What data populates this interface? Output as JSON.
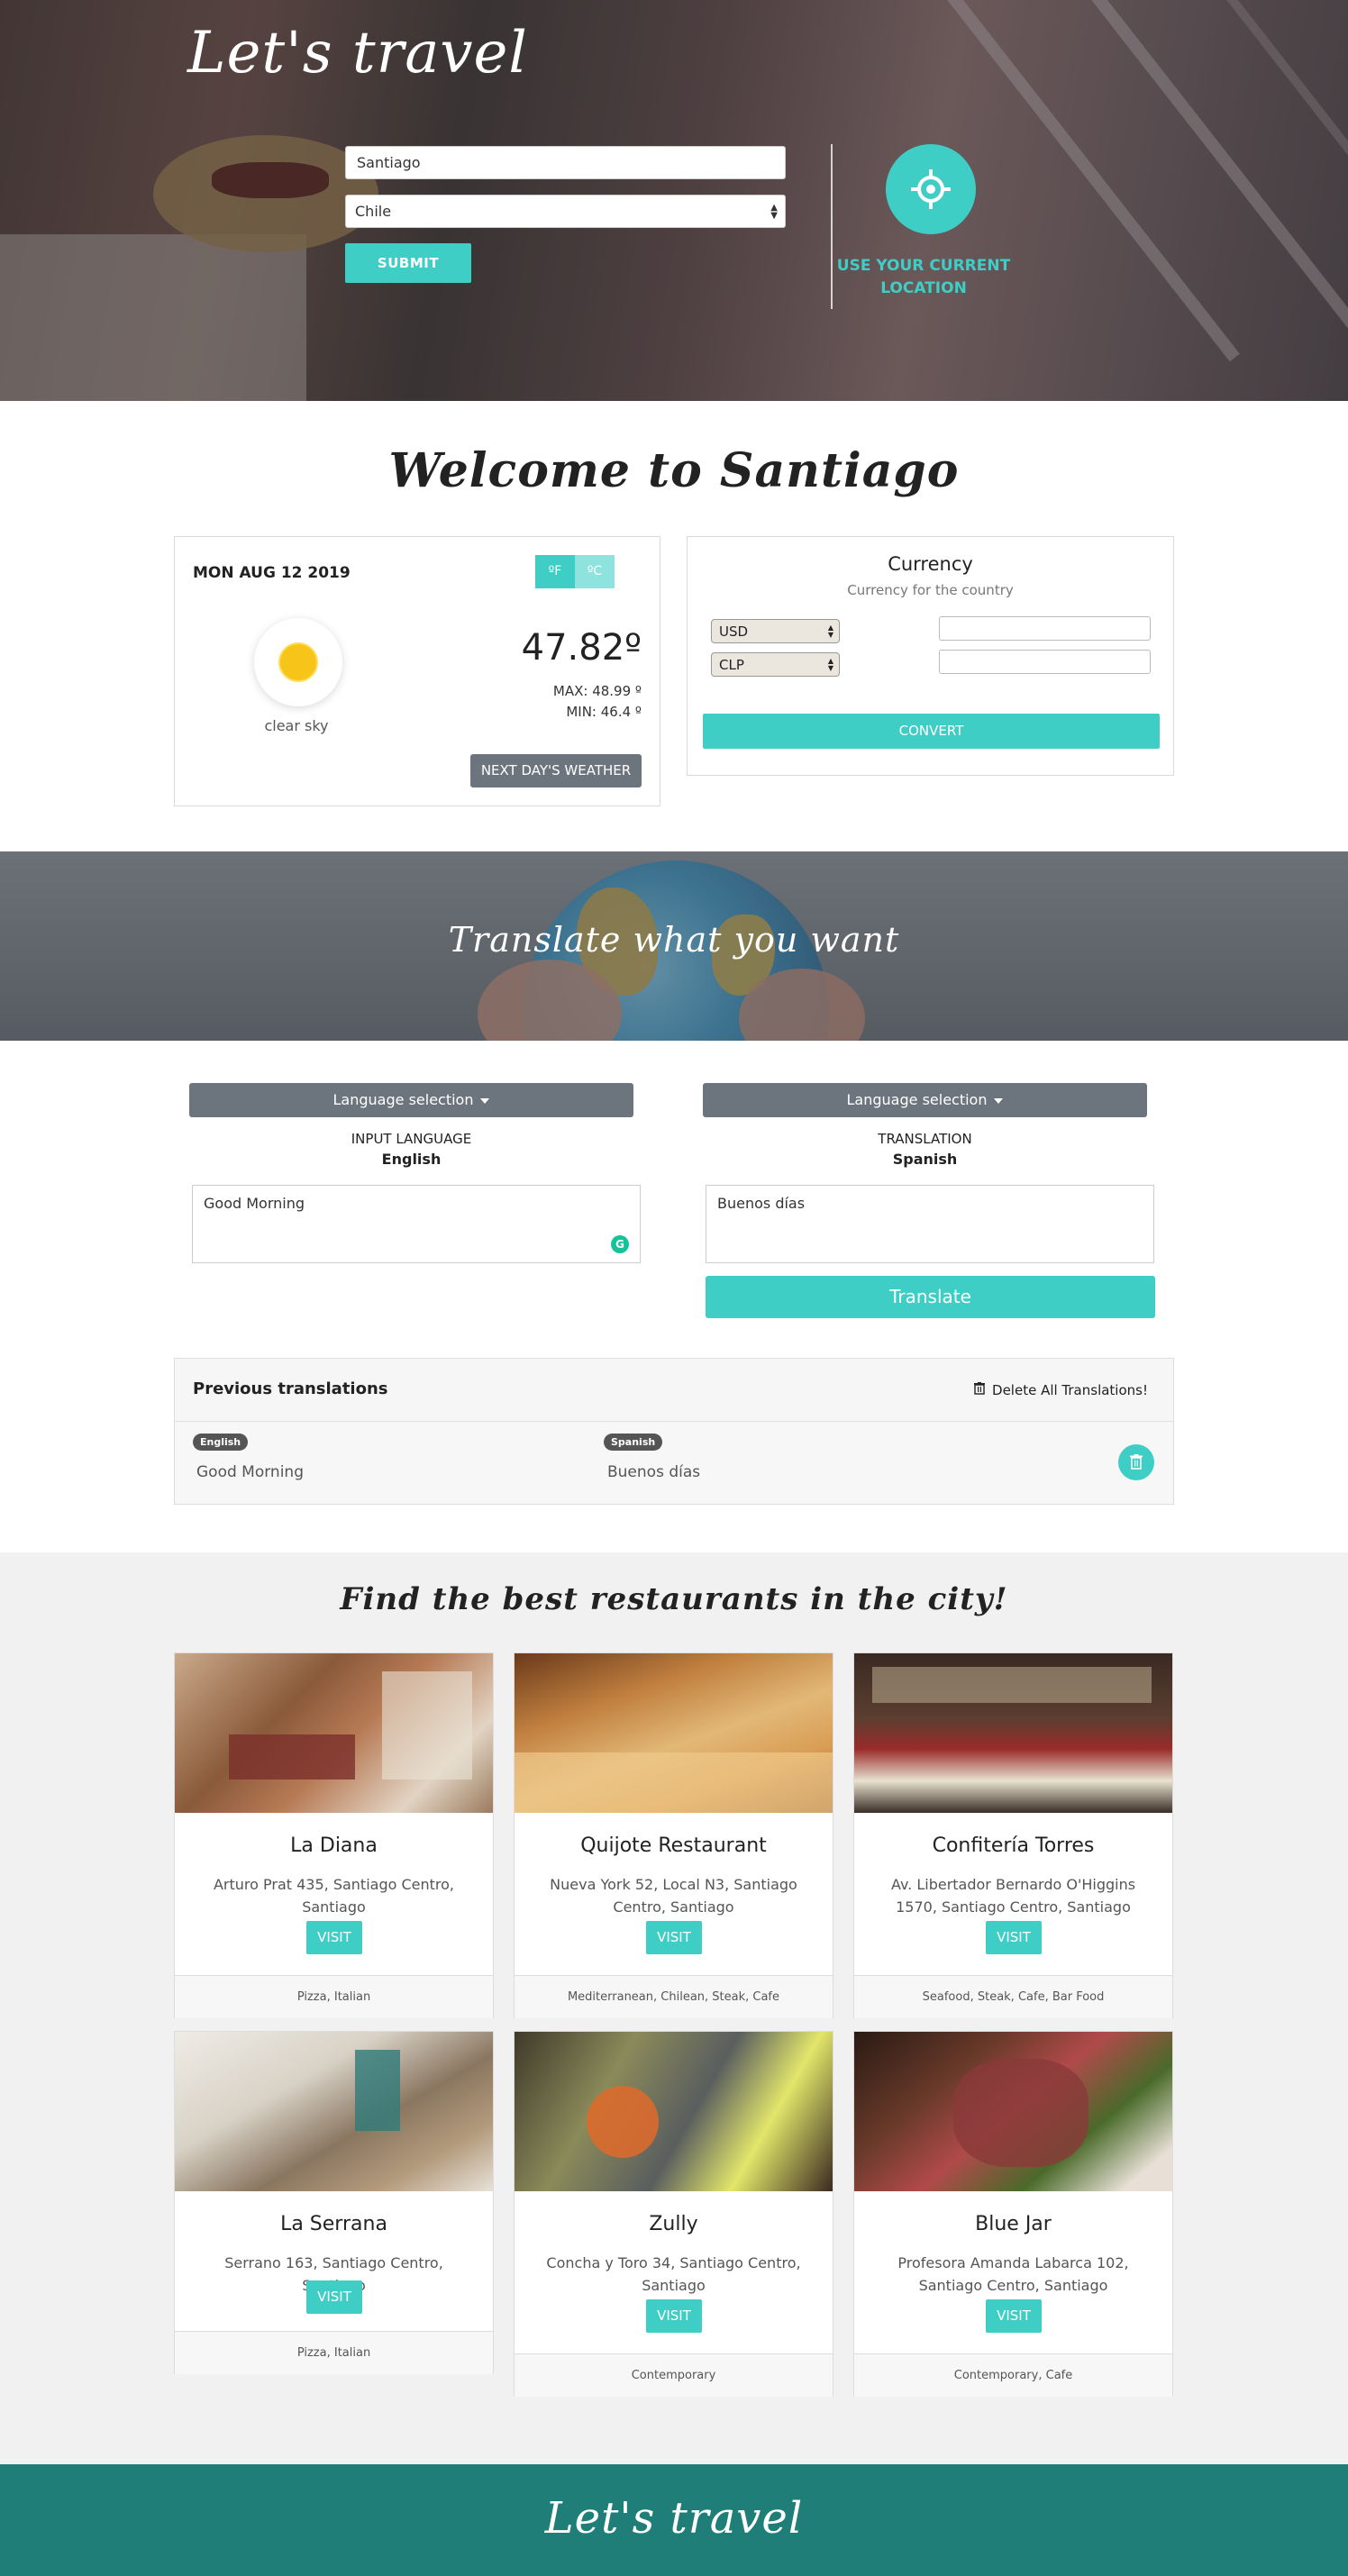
{
  "hero": {
    "title": "Let's travel",
    "city_value": "Santiago",
    "country_selected": "Chile",
    "submit_label": "SUBMIT",
    "location_label": "USE YOUR CURRENT LOCATION"
  },
  "welcome": {
    "title": "Welcome to Santiago"
  },
  "weather": {
    "date": "MON AUG 12 2019",
    "unit_f": "ºF",
    "unit_c": "ºC",
    "description": "clear sky",
    "temp": "47.82º",
    "max": "MAX: 48.99 º",
    "min": "MIN: 46.4 º",
    "next_label": "NEXT DAY'S WEATHER",
    "icon": "sun-icon"
  },
  "currency": {
    "title": "Currency",
    "subtitle": "Currency for the country",
    "from": "USD",
    "to": "CLP",
    "from_amount": "",
    "to_amount": "",
    "convert_label": "CONVERT"
  },
  "translate_banner": {
    "title": "Translate what you want"
  },
  "translate": {
    "input": {
      "selector_label": "Language selection",
      "caption": "INPUT LANGUAGE",
      "language": "English",
      "text": "Good Morning"
    },
    "output": {
      "selector_label": "Language selection",
      "caption": "TRANSLATION",
      "language": "Spanish",
      "text": "Buenos días"
    },
    "translate_label": "Translate"
  },
  "previous": {
    "title": "Previous translations",
    "delete_all_label": "Delete All Translations!",
    "items": [
      {
        "from_lang": "English",
        "from_text": "Good Morning",
        "to_lang": "Spanish",
        "to_text": "Buenos días"
      }
    ]
  },
  "restaurants": {
    "title": "Find the best restaurants in the city!",
    "visit_label": "VISIT",
    "items": [
      {
        "name": "La Diana",
        "address": "Arturo Prat 435, Santiago Centro, Santiago",
        "cuisine": "Pizza, Italian"
      },
      {
        "name": "Quijote Restaurant",
        "address": "Nueva York 52, Local N3, Santiago Centro, Santiago",
        "cuisine": "Mediterranean, Chilean, Steak, Cafe"
      },
      {
        "name": "Confitería Torres",
        "address": "Av. Libertador Bernardo O'Higgins 1570, Santiago Centro, Santiago",
        "cuisine": "Seafood, Steak, Cafe, Bar Food"
      },
      {
        "name": "La Serrana",
        "address": "Serrano 163, Santiago Centro, Santiago",
        "cuisine": "Pizza, Italian"
      },
      {
        "name": "Zully",
        "address": "Concha y Toro 34, Santiago Centro, Santiago",
        "cuisine": "Contemporary"
      },
      {
        "name": "Blue Jar",
        "address": "Profesora Amanda Labarca 102, Santiago Centro, Santiago",
        "cuisine": "Contemporary, Cafe"
      }
    ]
  },
  "footer": {
    "title": "Let's travel"
  },
  "colors": {
    "accent": "#3ecec6",
    "footer": "#1f7f78",
    "secondary": "#6c757d"
  }
}
